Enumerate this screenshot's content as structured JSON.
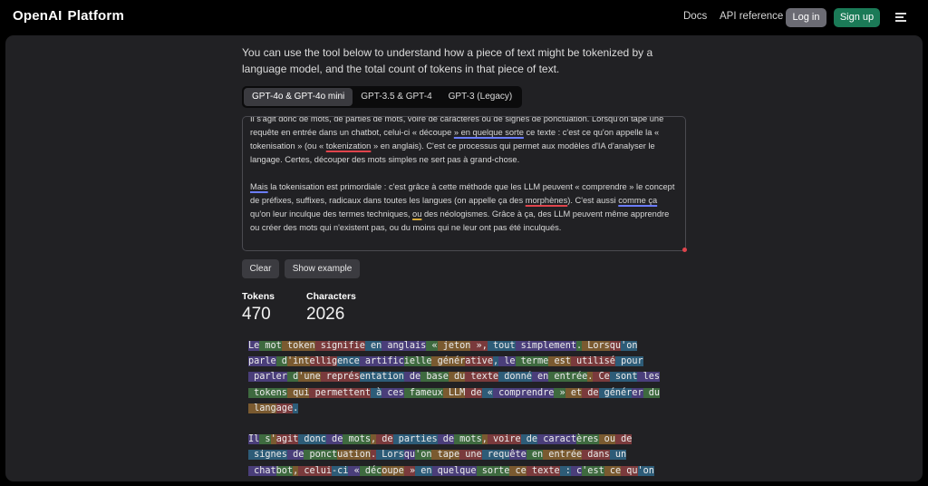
{
  "header": {
    "brand_logo": "OpenAI",
    "brand_product": "Platform",
    "links": [
      "Docs",
      "API reference"
    ],
    "login_label": "Log in",
    "signup_label": "Sign up",
    "menu_icon": "hamburger-menu-icon"
  },
  "intro": "You can use the tool below to understand how a piece of text might be tokenized by a language model, and the total count of tokens in that piece of text.",
  "tabs": [
    "GPT-4o & GPT-4o mini",
    "GPT-3.5 & GPT-4",
    "GPT-3 (Legacy)"
  ],
  "active_tab": 0,
  "editor": {
    "paragraphs": [
      [
        {
          "t": "Il s'agit donc de mots, de parties de mots, voire de caractères ou de signes de ponctuation. Lorsqu'on tape une requête en entrée dans un chatbot, celui-ci « découpe "
        },
        {
          "t": "» en quelque sorte",
          "u": "b"
        },
        {
          "t": " ce texte : c'est ce qu'on appelle la « tokenisation » (ou « "
        },
        {
          "t": "tokenization",
          "u": "r"
        },
        {
          "t": " » en anglais). C'est ce processus qui permet aux modèles d'IA d'analyser le langage. Certes, découper des mots simples ne sert pas à grand-chose."
        }
      ],
      [
        {
          "t": "Mais",
          "u": "b"
        },
        {
          "t": " la tokenisation est primordiale : c'est grâce à cette méthode que les LLM peuvent « comprendre » le concept de préfixes, suffixes, radicaux dans toutes les langues (on appelle ça des "
        },
        {
          "t": "morphènes",
          "u": "r"
        },
        {
          "t": "). C'est aussi "
        },
        {
          "t": "comme ça",
          "u": "b"
        },
        {
          "t": " qu'on leur inculque des termes techniques, "
        },
        {
          "t": "ou",
          "u": "y"
        },
        {
          "t": " des néologismes. Grâce à ça, des LLM peuvent même apprendre ou créer des mots qui n'existent pas, ou du moins qui ne leur ont pas été inculqués."
        }
      ],
      [
        {
          "t": "Les tokens font donc l'interface entre le langage humain et le langage machine. Le fait de décomposer le"
        }
      ]
    ]
  },
  "buttons": {
    "clear": "Clear",
    "show_example": "Show example"
  },
  "stats": {
    "tokens_label": "Tokens",
    "tokens_value": "470",
    "characters_label": "Characters",
    "characters_value": "2026"
  },
  "token_lines": [
    [
      "Le",
      " mot",
      " token",
      " signifie",
      " en",
      " anglais",
      " «",
      " jeton",
      " »,",
      " tout",
      " simplement",
      ".",
      " Lors",
      "qu",
      "'on"
    ],
    [
      "parle",
      " d",
      "'int",
      "ellig",
      "ence",
      " artific",
      "ielle",
      " génér",
      "ative",
      ",",
      " le",
      " terme",
      " est",
      " utilisé",
      " pour"
    ],
    [
      " parler",
      " d",
      "'une",
      " représ",
      "entation",
      " de",
      " base",
      " du",
      " texte",
      " donné",
      " en",
      " entrée",
      ".",
      " Ce",
      " sont",
      " les"
    ],
    [
      " tokens",
      " qui",
      " permettent",
      " à",
      " ces",
      " fameux",
      " LLM",
      " de",
      " «",
      " comprendre",
      " »",
      " et",
      " de",
      " génér",
      "er",
      " du"
    ],
    [
      " lang",
      "age",
      "."
    ],
    [],
    [
      "Il",
      " s",
      "'",
      "agit",
      " donc",
      " de",
      " mots",
      ",",
      " de",
      " parties",
      " de",
      " mots",
      ",",
      " voire",
      " de",
      " caract",
      "ères",
      " ou",
      " de"
    ],
    [
      " signes",
      " de",
      " ponct",
      "uation",
      ".",
      " Lors",
      "qu",
      "'on",
      " tape",
      " une",
      " requ",
      "ête",
      " en",
      " entrée",
      " dans",
      " un"
    ],
    [
      " chat",
      "bot",
      ",",
      " celui",
      "-ci",
      " «",
      " déc",
      "oupe",
      " »",
      " en",
      " quelque",
      " sorte",
      " ce",
      " texte",
      " :",
      " c",
      "'est",
      " ce",
      " qu",
      "'on"
    ]
  ]
}
